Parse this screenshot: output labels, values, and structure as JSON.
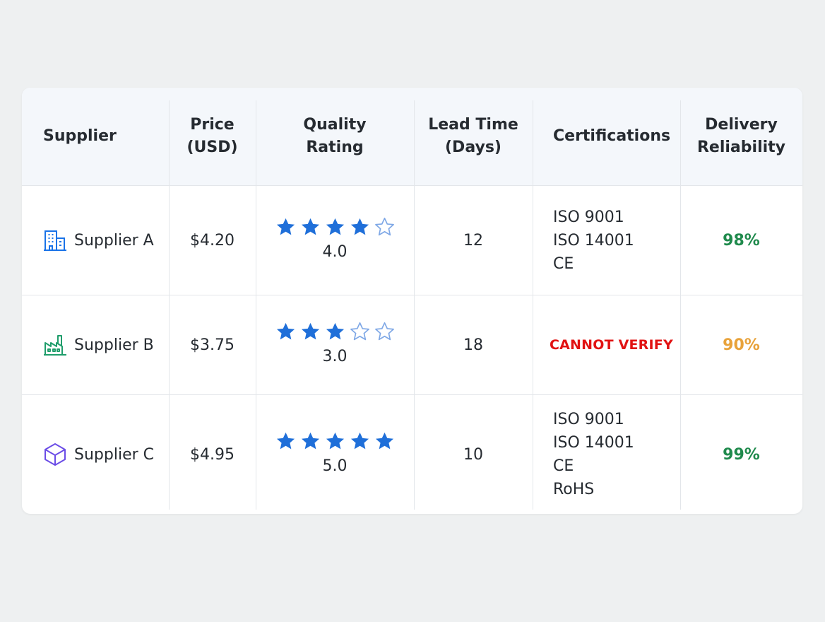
{
  "table": {
    "headers": {
      "supplier": "Supplier",
      "price": "Price\n(USD)",
      "quality": "Quality\nRating",
      "lead_time": "Lead Time\n(Days)",
      "certifications": "Certifications",
      "delivery": "Delivery\nReliability"
    },
    "rows": [
      {
        "supplier": "Supplier A",
        "icon": "building-icon",
        "icon_color": "#1a73e8",
        "price": "$4.20",
        "rating_stars": 4,
        "rating": "4.0",
        "lead_time": "12",
        "certifications": [
          "ISO 9001",
          "ISO 14001",
          "CE"
        ],
        "delivery": "98%",
        "delivery_color": "#1f8a4c"
      },
      {
        "supplier": "Supplier B",
        "icon": "factory-icon",
        "icon_color": "#1f9d6b",
        "price": "$3.75",
        "rating_stars": 3,
        "rating": "3.0",
        "lead_time": "18",
        "certifications_status": "CANNOT VERIFY",
        "delivery": "90%",
        "delivery_color": "#e8a23a"
      },
      {
        "supplier": "Supplier C",
        "icon": "cube-icon",
        "icon_color": "#6b4de6",
        "price": "$4.95",
        "rating_stars": 5,
        "rating": "5.0",
        "lead_time": "10",
        "certifications": [
          "ISO 9001",
          "ISO 14001",
          "CE",
          "RoHS"
        ],
        "delivery": "99%",
        "delivery_color": "#1f8a4c"
      }
    ]
  },
  "colors": {
    "star_filled": "#1f6fd9",
    "star_outline": "#7fa8e6",
    "warning_red": "#e11313"
  }
}
